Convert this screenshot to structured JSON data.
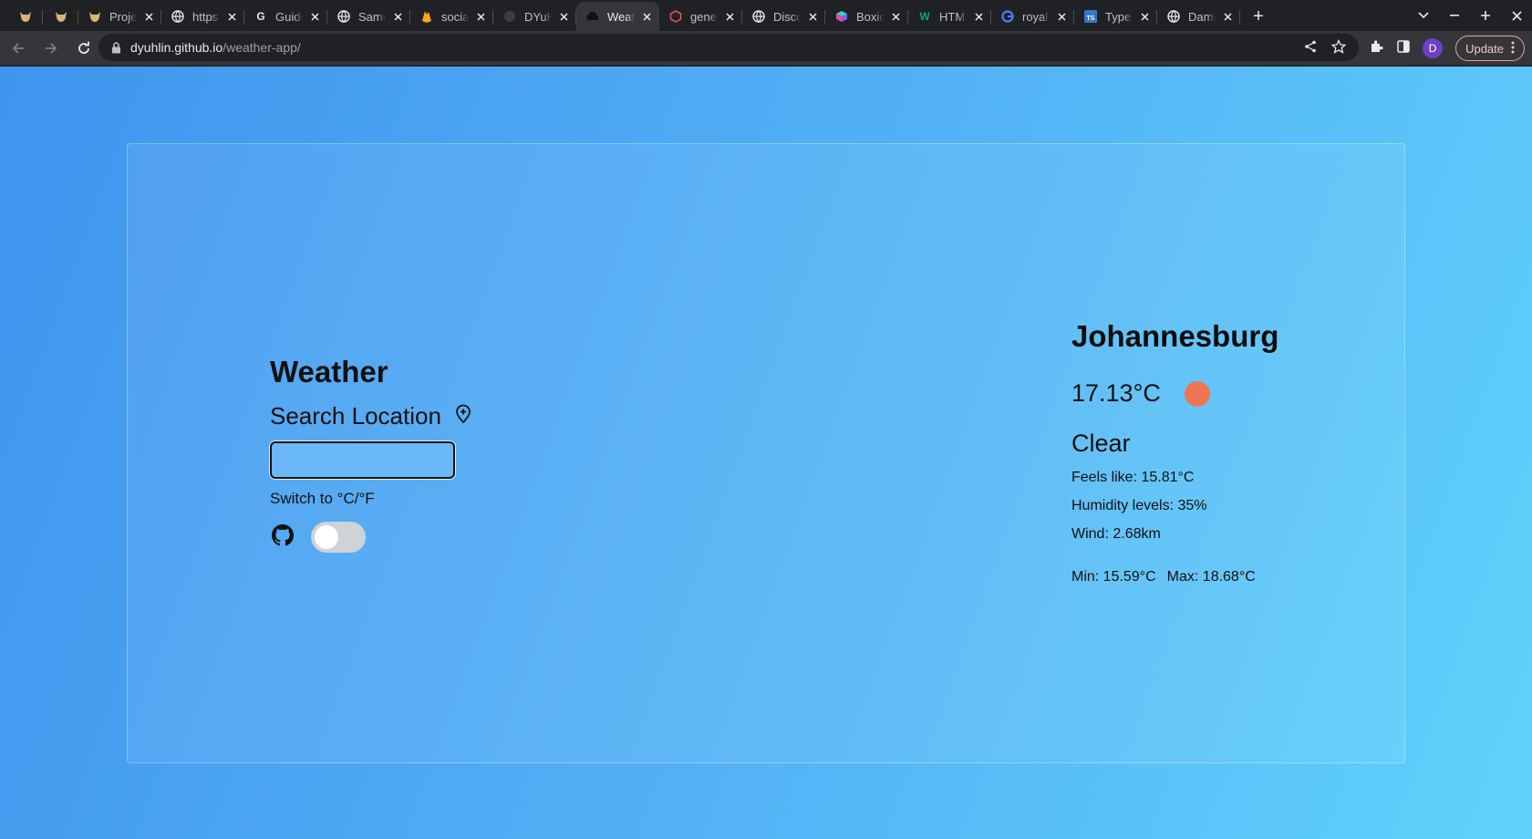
{
  "browser": {
    "tabs": [
      {
        "title": "",
        "icon": "bull-icon",
        "pinned": true
      },
      {
        "title": "",
        "icon": "bull-icon",
        "pinned": true
      },
      {
        "title": "Projec",
        "icon": "bull-icon"
      },
      {
        "title": "https:/",
        "icon": "globe-icon"
      },
      {
        "title": "Guido",
        "icon": "google-g-icon"
      },
      {
        "title": "Samu",
        "icon": "globe-icon"
      },
      {
        "title": "social",
        "icon": "firebase-icon"
      },
      {
        "title": "DYuHl",
        "icon": "github-icon"
      },
      {
        "title": "Weath",
        "icon": "cloud-icon",
        "active": true
      },
      {
        "title": "geneT",
        "icon": "hexagon-icon"
      },
      {
        "title": "Discor",
        "icon": "globe-icon"
      },
      {
        "title": "Boxicc",
        "icon": "boxicons-icon"
      },
      {
        "title": "HTML",
        "icon": "w-icon"
      },
      {
        "title": "royalt",
        "icon": "google-icon"
      },
      {
        "title": "TypeS",
        "icon": "ts-icon"
      },
      {
        "title": "Dami",
        "icon": "globe-icon"
      }
    ],
    "address": {
      "host": "dyuhlin.github.io",
      "path": "/weather-app/"
    },
    "profile_initial": "D",
    "update_label": "Update"
  },
  "app": {
    "title": "Weather",
    "search_label": "Search Location",
    "search_value": "",
    "switch_label": "Switch to °C/°F",
    "unit_toggle_on": false
  },
  "weather": {
    "city": "Johannesburg",
    "temp": "17.13°C",
    "condition": "Clear",
    "feels_like": "Feels like: 15.81°C",
    "humidity": "Humidity levels: 35%",
    "wind": "Wind: 2.68km",
    "min": "Min: 15.59°C",
    "max": "Max: 18.68°C"
  },
  "colors": {
    "sun": "#f07452",
    "bg_start": "#3f94ee",
    "bg_end": "#5fd2fb"
  }
}
